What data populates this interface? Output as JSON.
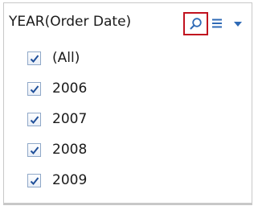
{
  "filter": {
    "title": "YEAR(Order Date)",
    "icons": {
      "search": "search-icon",
      "menu": "list-menu-icon",
      "dropdown": "dropdown-arrow-icon"
    },
    "items": [
      {
        "label": "(All)",
        "checked": true
      },
      {
        "label": "2006",
        "checked": true
      },
      {
        "label": "2007",
        "checked": true
      },
      {
        "label": "2008",
        "checked": true
      },
      {
        "label": "2009",
        "checked": true
      }
    ]
  },
  "colors": {
    "highlight_border": "#c1121f",
    "icon_blue": "#2f6ab6",
    "check_blue": "#1f4f99"
  }
}
